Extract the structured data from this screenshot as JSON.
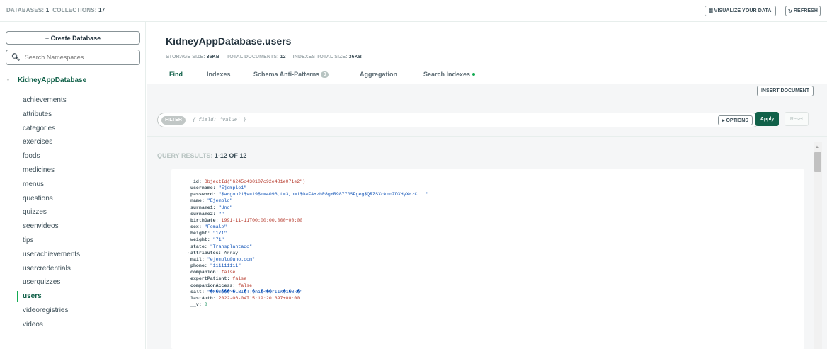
{
  "topbar": {
    "databases_label": "DATABASES:",
    "databases_count": "1",
    "collections_label": "COLLECTIONS:",
    "collections_count": "17",
    "visualize_label": "VISUALIZE YOUR DATA",
    "visualize_icon": "bar-chart-icon",
    "refresh_label": "REFRESH",
    "refresh_icon": "refresh-icon"
  },
  "sidebar": {
    "create_db_label": "+ Create Database",
    "search_placeholder": "Search Namespaces",
    "database": "KidneyAppDatabase",
    "collections": [
      "achievements",
      "attributes",
      "categories",
      "exercises",
      "foods",
      "medicines",
      "menus",
      "questions",
      "quizzes",
      "seenvideos",
      "tips",
      "userachievements",
      "usercredentials",
      "userquizzes",
      "users",
      "videoregistries",
      "videos"
    ],
    "active_collection": "users"
  },
  "header": {
    "title": "KidneyAppDatabase.users",
    "storage_label": "STORAGE SIZE:",
    "storage_value": "36KB",
    "docs_label": "TOTAL DOCUMENTS:",
    "docs_value": "12",
    "indexes_label": "INDEXES TOTAL SIZE:",
    "indexes_value": "36KB",
    "tabs": [
      {
        "label": "Find"
      },
      {
        "label": "Indexes"
      },
      {
        "label": "Schema Anti-Patterns",
        "badge": "0"
      },
      {
        "label": "Aggregation"
      },
      {
        "label": "Search Indexes"
      }
    ]
  },
  "query": {
    "insert_label": "INSERT DOCUMENT",
    "filter_pill": "FILTER",
    "filter_placeholder": "{ field: 'value' }",
    "options_label": "▸ OPTIONS",
    "apply_label": "Apply",
    "reset_label": "Reset",
    "results_prefix": "QUERY RESULTS:",
    "results_range": "1-12 OF 12"
  },
  "document": [
    {
      "key": "_id",
      "value": "ObjectId(\"6245c430107c92e481e071e2\")",
      "type": "oid"
    },
    {
      "key": "username",
      "value": "\"Ejemplo1\"",
      "type": "str"
    },
    {
      "key": "password",
      "value": "\"$argon2i$v=19$m=4096,t=3,p=1$0aFA+zhR8gYR9877GSPgeg$QRZSXckmnZDXHyXrzC...\"",
      "type": "str"
    },
    {
      "key": "name",
      "value": "\"Ejemplo\"",
      "type": "str"
    },
    {
      "key": "surname1",
      "value": "\"Uno\"",
      "type": "str"
    },
    {
      "key": "surname2",
      "value": "\"\"",
      "type": "str"
    },
    {
      "key": "birthDate",
      "value": "1991-11-11T00:00:00.000+00:00",
      "type": "date"
    },
    {
      "key": "sex",
      "value": "\"Female\"",
      "type": "str"
    },
    {
      "key": "height",
      "value": "\"171\"",
      "type": "str"
    },
    {
      "key": "weight",
      "value": "\"71\"",
      "type": "str"
    },
    {
      "key": "state",
      "value": "\"Transplantado\"",
      "type": "str"
    },
    {
      "key": "attributes",
      "value": "Array",
      "type": "arr",
      "expandable": true
    },
    {
      "key": "mail",
      "value": "\"ejemplo@uno.com\"",
      "type": "str"
    },
    {
      "key": "phone",
      "value": "\"111111111\"",
      "type": "str"
    },
    {
      "key": "companion",
      "value": "false",
      "type": "bool"
    },
    {
      "key": "expertPatient",
      "value": "false",
      "type": "bool"
    },
    {
      "key": "companionAccess",
      "value": "false",
      "type": "bool"
    },
    {
      "key": "salt",
      "value": "\"�N�m���\\�LBI�T|�ni�<��rII%�1�8k�\"",
      "type": "str"
    },
    {
      "key": "lastAuth",
      "value": "2022-06-04T15:19:20.397+00:00",
      "type": "date"
    },
    {
      "key": "__v",
      "value": "0",
      "type": "num"
    }
  ],
  "colors": {
    "accent_green": "#116149",
    "active_bar": "#13aa52",
    "string_value": "#1254b7",
    "special_value": "#b63a2c"
  }
}
